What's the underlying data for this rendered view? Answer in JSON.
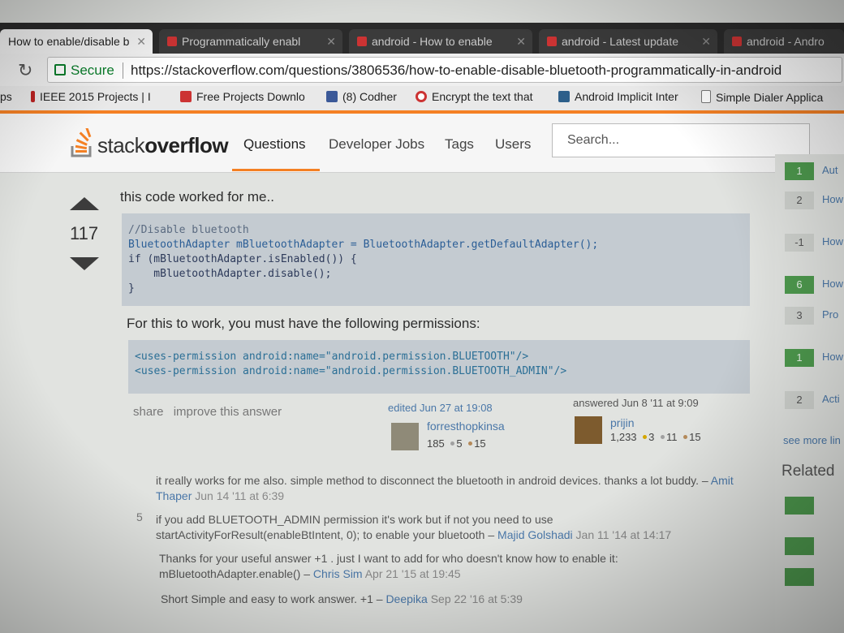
{
  "tabs": [
    {
      "label": "How to enable/disable b",
      "active": true
    },
    {
      "label": "Programmatically enabl",
      "active": false
    },
    {
      "label": "android - How to enable",
      "active": false
    },
    {
      "label": "android - Latest update",
      "active": false
    },
    {
      "label": "android - Andro",
      "active": false
    }
  ],
  "address": {
    "secure_label": "Secure",
    "url": "https://stackoverflow.com/questions/3806536/how-to-enable-disable-bluetooth-programmatically-in-android"
  },
  "bookmarks": [
    {
      "label": "ps",
      "icon": "apps-icon"
    },
    {
      "label": "IEEE 2015 Projects | I",
      "icon": "bookmark-icon"
    },
    {
      "label": "Free Projects Downlo",
      "icon": "fp-icon"
    },
    {
      "label": "(8) Codher",
      "icon": "facebook-icon"
    },
    {
      "label": "Encrypt the text that",
      "icon": "target-icon"
    },
    {
      "label": "Android Implicit Inter",
      "icon": "page-icon"
    },
    {
      "label": "Simple Dialer Applica",
      "icon": "document-icon"
    }
  ],
  "site": {
    "logo_plain": "stack",
    "logo_bold": "overflow",
    "nav": [
      "Questions",
      "Developer Jobs",
      "Tags",
      "Users"
    ],
    "search_placeholder": "Search..."
  },
  "answer": {
    "votes": "117",
    "intro": "this code worked for me..",
    "code1": [
      "//Disable bluetooth",
      "BluetoothAdapter mBluetoothAdapter = BluetoothAdapter.getDefaultAdapter();",
      "if (mBluetoothAdapter.isEnabled()) {",
      "    mBluetoothAdapter.disable();",
      "}"
    ],
    "para": "For this to work, you must have the following permissions:",
    "code2": [
      "<uses-permission android:name=\"android.permission.BLUETOOTH\"/>",
      "<uses-permission android:name=\"android.permission.BLUETOOTH_ADMIN\"/>"
    ],
    "menu": [
      "share",
      "improve this answer"
    ],
    "edited": {
      "action": "edited Jun 27 at 19:08",
      "user": "forresthopkinsa",
      "rep": "185",
      "silver": "5",
      "bronze": "15"
    },
    "answered": {
      "action": "answered Jun 8 '11 at 9:09",
      "user": "prijin",
      "rep": "1,233",
      "gold": "3",
      "silver": "11",
      "bronze": "15"
    }
  },
  "comments": [
    {
      "votes": "",
      "text": "it really works for me also. simple method to disconnect the bluetooth in android devices. thanks a lot buddy.",
      "author": "Amit Thaper",
      "date": "Jun 14 '11 at 6:39"
    },
    {
      "votes": "5",
      "text": "if you add BLUETOOTH_ADMIN permission it's work but if not you need to use startActivityForResult(enableBtIntent, 0); to enable your bluetooth",
      "author": "Majid Golshadi",
      "date": "Jan 11 '14 at 14:17"
    },
    {
      "votes": "",
      "text": "Thanks for your useful answer +1 . just I want to add for who doesn't know how to enable it: mBluetoothAdapter.enable()",
      "author": "Chris Sim",
      "date": "Apr 21 '15 at 19:45"
    },
    {
      "votes": "",
      "text": "Short Simple and easy to work answer. +1",
      "author": "Deepika",
      "date": "Sep 22 '16 at 5:39"
    }
  ],
  "sidebar": {
    "linked": [
      {
        "score": "1",
        "title": "Aut",
        "green": true
      },
      {
        "score": "2",
        "title": "How",
        "green": false
      },
      {
        "score": "-1",
        "title": "How",
        "green": false
      },
      {
        "score": "6",
        "title": "How",
        "green": true
      },
      {
        "score": "3",
        "title": "Pro",
        "green": false
      },
      {
        "score": "1",
        "title": "How",
        "green": true
      },
      {
        "score": "2",
        "title": "Acti",
        "green": false
      }
    ],
    "see_more": "see more lin",
    "related_title": "Related"
  },
  "colors": {
    "accent": "#f48024",
    "link": "#4a77a8",
    "accepted": "#4e9a4e"
  }
}
